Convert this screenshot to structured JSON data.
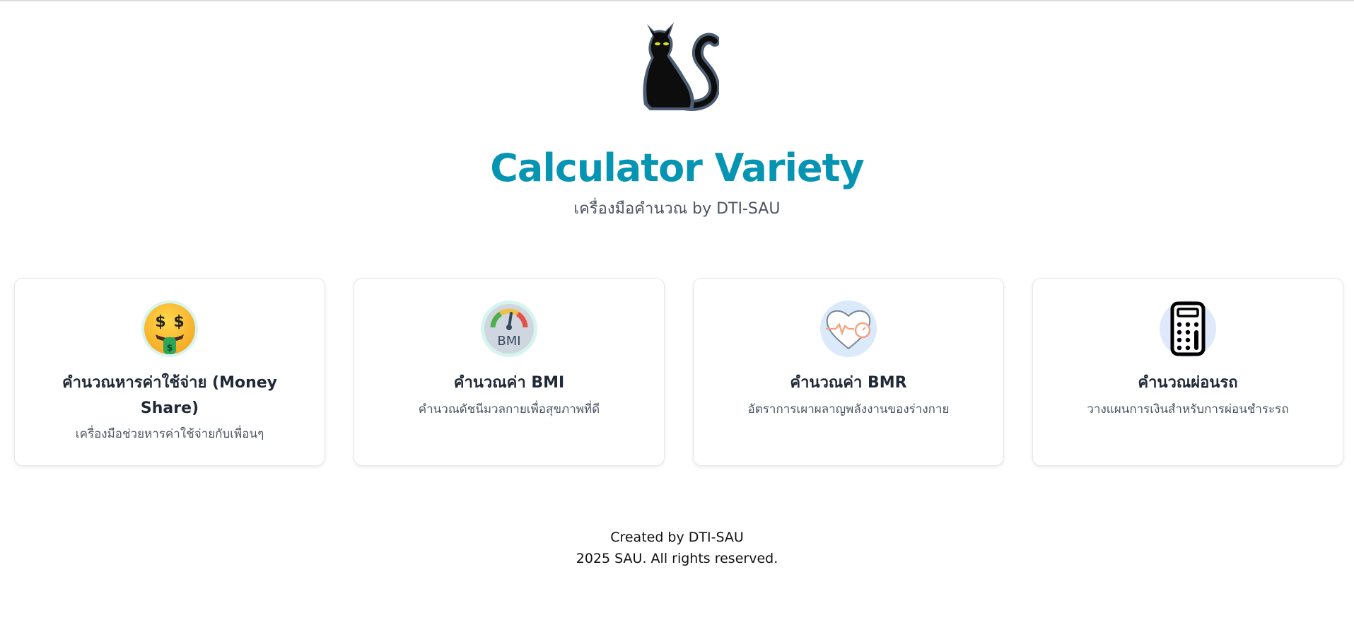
{
  "header": {
    "logo_icon": "black-cat-icon",
    "title": "Calculator Variety",
    "subtitle": "เครื่องมือคำนวณ by DTI-SAU",
    "title_color": "#0694b3"
  },
  "cards": [
    {
      "icon": "money-mouth-face-icon",
      "title": "คำนวณหารค่าใช้จ่าย (Money Share)",
      "description": "เครื่องมือช่วยหารค่าใช้จ่ายกับเพื่อนๆ"
    },
    {
      "icon": "bmi-gauge-icon",
      "title": "คำนวณค่า BMI",
      "description": "คำนวณดัชนีมวลกายเพื่อสุขภาพที่ดี",
      "icon_label": "BMI"
    },
    {
      "icon": "heart-pulse-icon",
      "title": "คำนวณค่า BMR",
      "description": "อัตราการเผาผลาญพลังงานของร่างกาย"
    },
    {
      "icon": "calculator-icon",
      "title": "คำนวณผ่อนรถ",
      "description": "วางแผนการเงินสำหรับการผ่อนชำระรถ"
    }
  ],
  "footer": {
    "created_by": "Created by DTI-SAU",
    "copyright": "2025 SAU. All rights reserved."
  }
}
